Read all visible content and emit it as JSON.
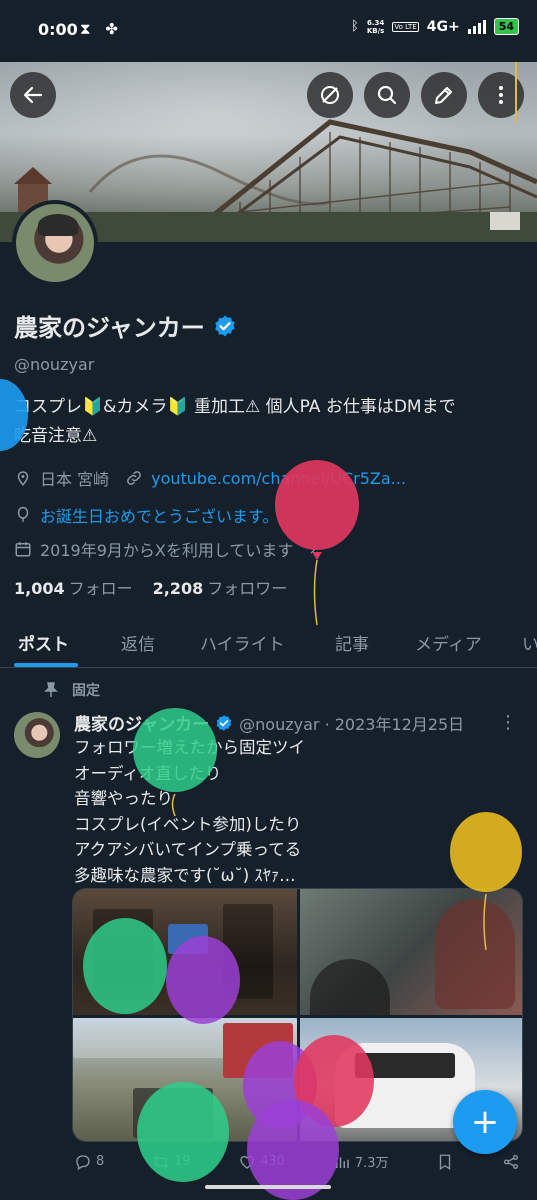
{
  "status_bar": {
    "time": "0:00",
    "speed_top": "6.34",
    "speed_unit": "KB/s",
    "volte": "Vo LTE",
    "network": "4G+",
    "battery": "54"
  },
  "profile": {
    "name": "農家のジャンカー",
    "handle": "@nouzyar",
    "bio_line1": "コスプレ🔰&カメラ🔰 重加工⚠ 個人PA お仕事はDMまで",
    "bio_line2": "吃音注意⚠",
    "location": "日本 宮崎",
    "website": "youtube.com/channel/UCr5Za...",
    "birthday": "お誕生日おめでとうございます。",
    "joined": "2019年9月からXを利用しています",
    "following_count": "1,004",
    "following_label": "フォロー",
    "followers_count": "2,208",
    "followers_label": "フォロワー"
  },
  "tabs": [
    {
      "label": "ポスト",
      "active": true
    },
    {
      "label": "返信"
    },
    {
      "label": "ハイライト"
    },
    {
      "label": "記事"
    },
    {
      "label": "メディア"
    },
    {
      "label": "い"
    }
  ],
  "post": {
    "pinned_label": "固定",
    "author": "農家のジャンカー",
    "handle_date": "@nouzyar · 2023年12月25日",
    "text": "フォロワー増えたから固定ツイ\nオーディオ直したり\n音響やったり\nコスプレ(イベント参加)したり\nアクアシバいてインプ乗ってる\n多趣味な農家です(˘ω˘) ｽﾔｧ…",
    "replies": "8",
    "reposts": "19",
    "likes": "430",
    "views": "7.3万"
  },
  "colors": {
    "background": "#15202b",
    "accent": "#1d9bf0",
    "text": "#e7e9ea",
    "muted": "#8b98a5"
  },
  "icons": [
    "back-arrow-icon",
    "no-notify-icon",
    "search-icon",
    "edit-icon",
    "more-vertical-icon",
    "verified-icon",
    "location-icon",
    "link-icon",
    "balloon-icon",
    "calendar-icon",
    "pin-icon",
    "reply-icon",
    "repost-icon",
    "like-icon",
    "views-icon",
    "bookmark-icon",
    "share-icon",
    "plus-icon"
  ]
}
